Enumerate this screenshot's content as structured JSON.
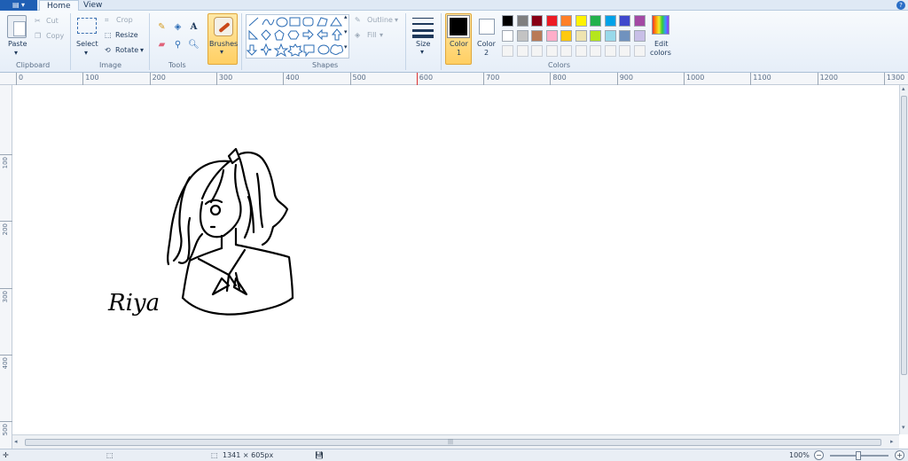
{
  "app_menu": {
    "icon": "app-menu-icon"
  },
  "tabs": [
    {
      "label": "Home"
    },
    {
      "label": "View"
    }
  ],
  "ribbon": {
    "clipboard": {
      "paste": "Paste",
      "cut": "Cut",
      "copy": "Copy",
      "group": "Clipboard"
    },
    "image": {
      "select": "Select",
      "crop": "Crop",
      "resize": "Resize",
      "rotate": "Rotate",
      "group": "Image"
    },
    "tools": {
      "group": "Tools"
    },
    "brushes": {
      "label": "Brushes"
    },
    "shapes": {
      "outline": "Outline",
      "fill": "Fill",
      "group": "Shapes"
    },
    "size": {
      "label": "Size"
    },
    "colors": {
      "color1": "Color\n1",
      "color1_a": "Color",
      "color1_b": "1",
      "color2_a": "Color",
      "color2_b": "2",
      "edit_a": "Edit",
      "edit_b": "colors",
      "group": "Colors",
      "palette": [
        "#000000",
        "#7f7f7f",
        "#880015",
        "#ed1c24",
        "#ff7f27",
        "#fff200",
        "#22b14c",
        "#00a2e8",
        "#3f48cc",
        "#a349a4",
        "#ffffff",
        "#c3c3c3",
        "#b97a57",
        "#ffaec9",
        "#ffc90e",
        "#efe4b0",
        "#b5e61d",
        "#99d9ea",
        "#7092be",
        "#c8bfe7"
      ]
    }
  },
  "rulers": {
    "h_ticks": [
      "0",
      "100",
      "200",
      "300",
      "400",
      "500",
      "600",
      "700",
      "800",
      "900",
      "1000",
      "1100",
      "1200",
      "1300"
    ],
    "v_ticks": [
      "100",
      "200",
      "300",
      "400",
      "500"
    ]
  },
  "canvas": {
    "signature": "Riya"
  },
  "status": {
    "dimensions": "1341 × 605px",
    "zoom": "100%"
  }
}
